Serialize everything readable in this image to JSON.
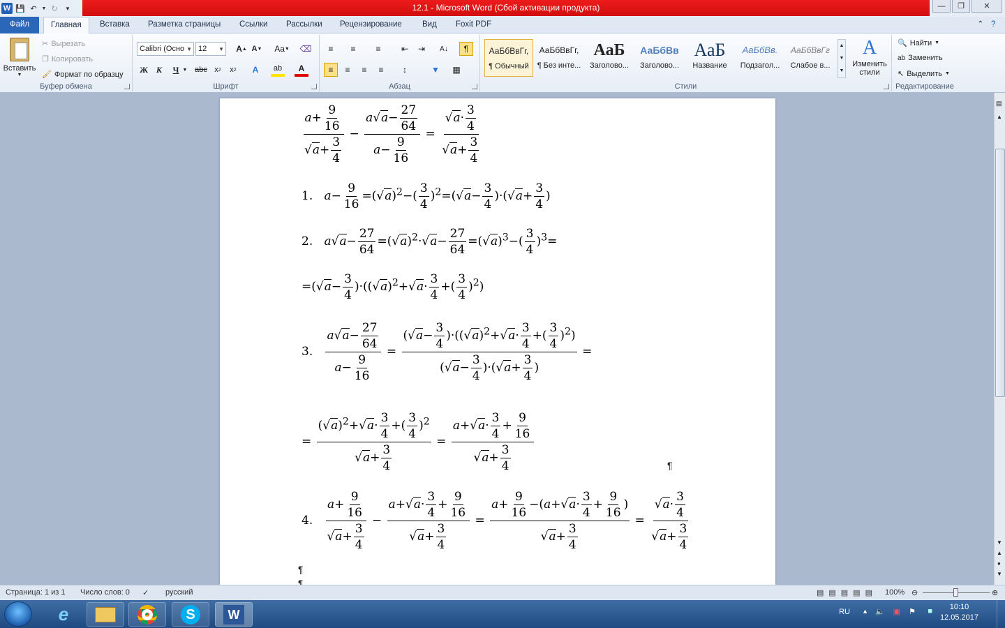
{
  "window": {
    "title": "12.1  -  Microsoft Word (Сбой активации продукта)"
  },
  "tabs": [
    "Файл",
    "Главная",
    "Вставка",
    "Разметка страницы",
    "Ссылки",
    "Рассылки",
    "Рецензирование",
    "Вид",
    "Foxit PDF"
  ],
  "ribbon": {
    "clipboard": {
      "paste": "Вставить",
      "cut": "Вырезать",
      "copy": "Копировать",
      "format_painter": "Формат по образцу",
      "group": "Буфер обмена"
    },
    "font": {
      "family": "Calibri (Осно",
      "size": "12",
      "group": "Шрифт"
    },
    "paragraph": {
      "group": "Абзац"
    },
    "styles": {
      "group": "Стили",
      "change_styles": "Изменить стили",
      "items": [
        {
          "sample": "АаБбВвГг,",
          "name": "¶ Обычный"
        },
        {
          "sample": "АаБбВвГг,",
          "name": "¶ Без инте..."
        },
        {
          "sample": "АаБ",
          "name": "Заголово..."
        },
        {
          "sample": "АаБбВв",
          "name": "Заголово..."
        },
        {
          "sample": "АаБ",
          "name": "Название"
        },
        {
          "sample": "АаБбВв.",
          "name": "Подзагол..."
        },
        {
          "sample": "АаБбВвГг",
          "name": "Слабое в..."
        }
      ]
    },
    "editing": {
      "find": "Найти",
      "replace": "Заменить",
      "select": "Выделить",
      "group": "Редактирование"
    }
  },
  "document": {
    "eq": {
      "step1": "1.",
      "step2": "2.",
      "step3": "3.",
      "step4": "4.",
      "a": "a",
      "n9": "9",
      "n16": "16",
      "n27": "27",
      "n64": "64",
      "n3": "3",
      "n4": "4",
      "minus": "−",
      "plus": "+",
      "eq": "=",
      "dot": "·"
    },
    "pilcrow": "¶"
  },
  "status": {
    "page": "Страница: 1 из 1",
    "words": "Число слов: 0",
    "language": "русский",
    "zoom": "100%"
  },
  "taskbar": {
    "lang": "RU",
    "time": "10:10",
    "date": "12.05.2017"
  }
}
